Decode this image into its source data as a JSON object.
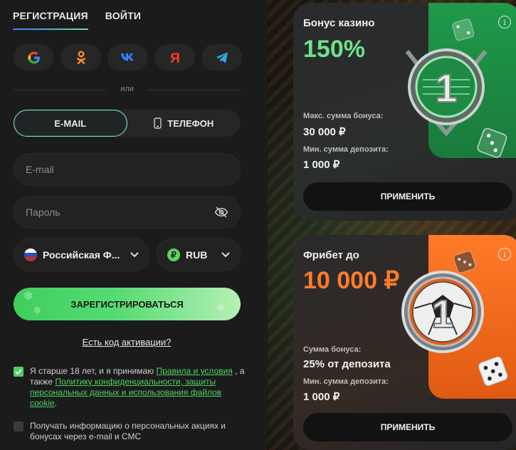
{
  "auth_tabs": [
    {
      "label": "РЕГИСТРАЦИЯ",
      "active": true
    },
    {
      "label": "ВОЙТИ",
      "active": false
    }
  ],
  "social_buttons": [
    {
      "icon": "google-icon"
    },
    {
      "icon": "odnoklassniki-icon"
    },
    {
      "icon": "vk-icon"
    },
    {
      "icon": "yandex-icon"
    },
    {
      "icon": "telegram-icon"
    }
  ],
  "divider_text": "или",
  "method_switch": {
    "email_label": "E-MAIL",
    "phone_label": "ТЕЛЕФОН",
    "active": "email"
  },
  "form": {
    "email_placeholder": "E-mail",
    "password_placeholder": "Пароль",
    "country_value": "Российская Ф...",
    "currency_value": "RUB",
    "currency_symbol": "₽",
    "register_label": "ЗАРЕГИСТРИРОВАТЬСЯ",
    "promo_link": "Есть код активации?"
  },
  "agreements": {
    "terms_checked": true,
    "terms_text_1": "Я старше 18 лет, и я принимаю ",
    "terms_link_1": "Правила и условия",
    "terms_text_2": " , а также ",
    "terms_link_2": "Политику конфиденциальности, защиты персональных данных и использования файлов cookie",
    "terms_text_3": ".",
    "promo_checked": false,
    "promo_text": "Получать информацию о персональных акциях и бонусах через e-mail и СМС"
  },
  "bonus_cards": [
    {
      "title": "Бонус казино",
      "value": "150%",
      "line1_label": "Макс. сумма бонуса:",
      "line1_value": "30 000 ₽",
      "line2_label": "Мин. сумма депозита:",
      "line2_value": "1 000 ₽",
      "button": "ПРИМЕНИТЬ",
      "medal_number": "1",
      "accent": "#6ee38a"
    },
    {
      "title": "Фрибет до",
      "value": "10 000 ₽",
      "line1_label": "Сумма бонуса:",
      "line1_value": "25% от депозита",
      "line2_label": "Мин. сумма депозита:",
      "line2_value": "1 000 ₽",
      "button": "ПРИМЕНИТЬ",
      "medal_number": "1",
      "accent": "#ff7c2c"
    }
  ],
  "info_icon_glyph": "i"
}
